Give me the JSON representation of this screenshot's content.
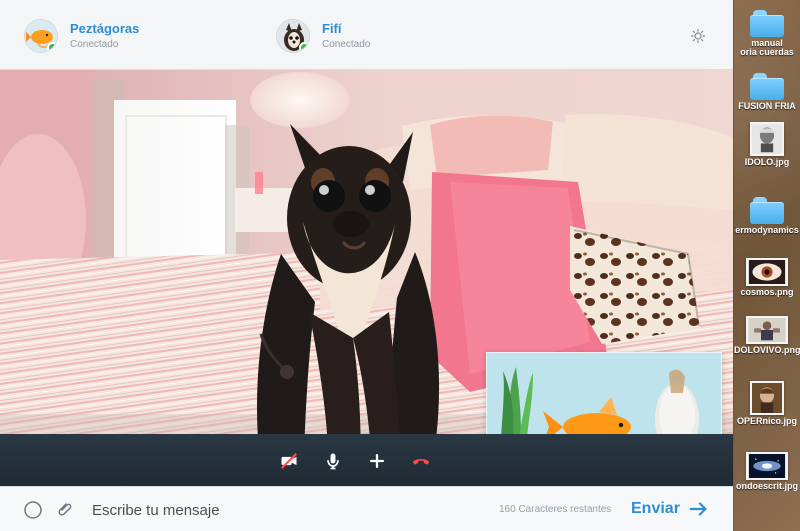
{
  "header": {
    "contacts": [
      {
        "name": "Peztágoras",
        "status": "Conectado"
      },
      {
        "name": "Fifí",
        "status": "Conectado"
      }
    ]
  },
  "composer": {
    "message_placeholder": "Escribe tu mensaje",
    "characters_remaining": "160 Caracteres restantes",
    "send_label": "Enviar"
  },
  "desktop": {
    "items": [
      {
        "label": "manual\noria cuerdas"
      },
      {
        "label": "FUSIÓN FRÍA"
      },
      {
        "label": "IDOLO.jpg"
      },
      {
        "label": "ermodynamics"
      },
      {
        "label": "cosmos.png"
      },
      {
        "label": "DOLOVIVO.png"
      },
      {
        "label": "OPERnico.jpg"
      },
      {
        "label": "ondoescrit.jpg"
      }
    ]
  },
  "icons": {
    "settings": "gear-icon",
    "camera_off": "camera-off-icon",
    "microphone": "microphone-icon",
    "add": "plus-icon",
    "hang_up": "hang-up-icon",
    "emoji": "emoji-icon",
    "attach": "paperclip-icon",
    "send": "arrow-right-icon",
    "folder": "folder-icon"
  },
  "colors": {
    "accent": "#2f8ed2",
    "online": "#40b64d",
    "call_bar": "#24313b",
    "hang_up": "#ff4d4d"
  }
}
